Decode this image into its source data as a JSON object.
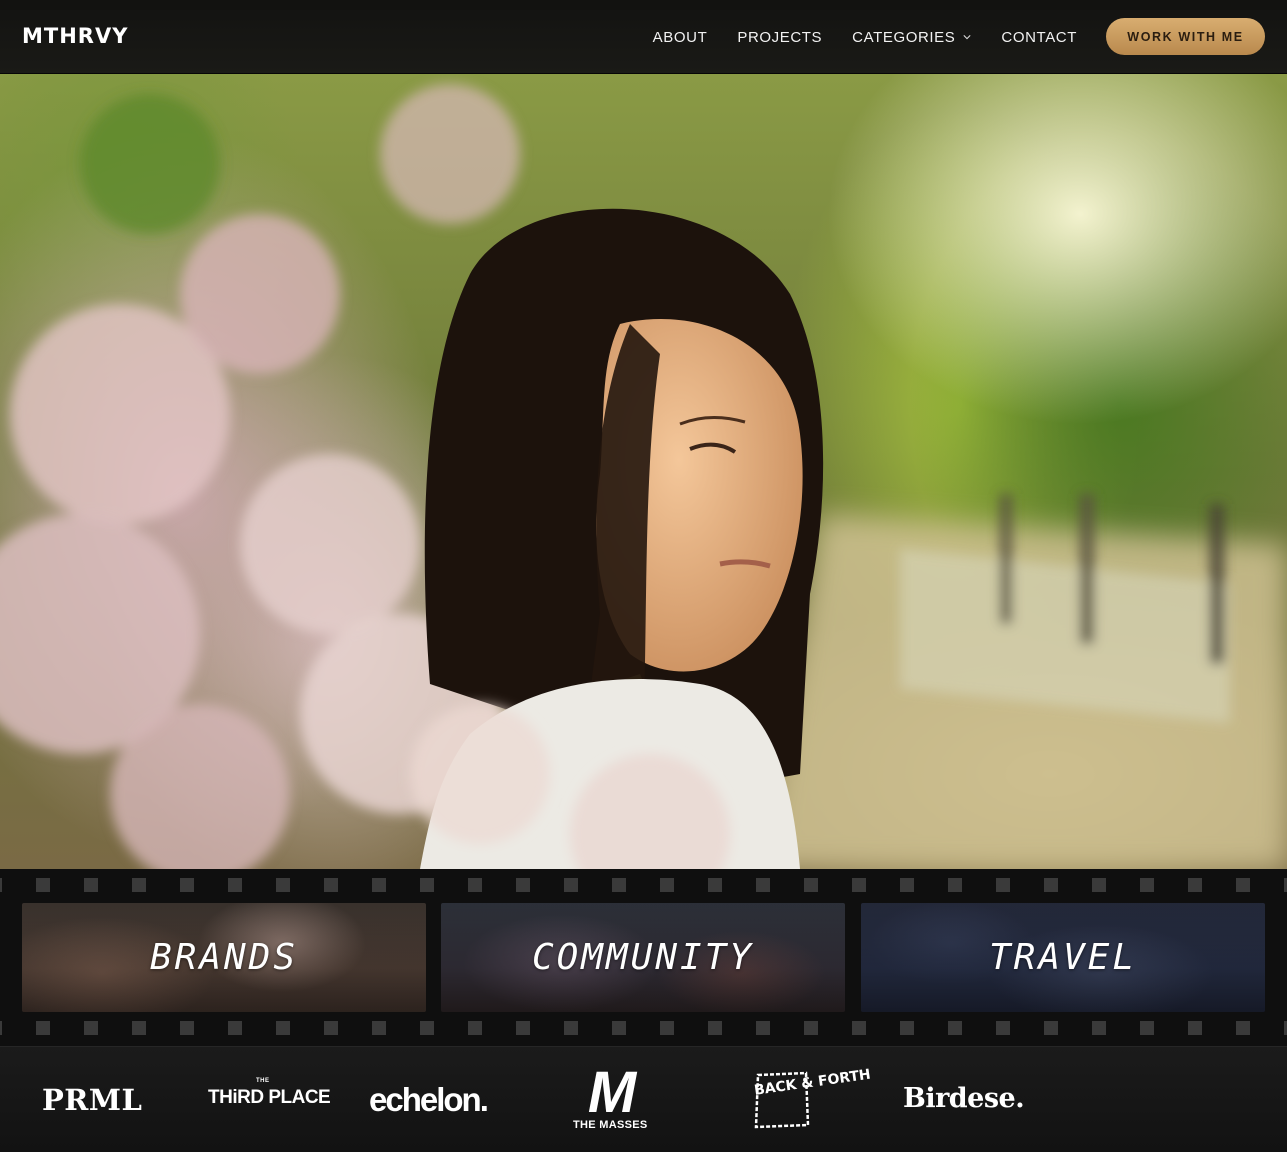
{
  "header": {
    "logo": "MTHRVY",
    "nav": {
      "about": "ABOUT",
      "projects": "PROJECTS",
      "categories": "CATEGORIES",
      "contact": "CONTACT"
    },
    "cta_label": "WORK WITH ME"
  },
  "hero": {
    "image_subject": "woman-beside-lilac-bush-on-sunlit-path"
  },
  "categories": {
    "brands": "BRANDS",
    "community": "COMMUNITY",
    "travel": "TRAVEL"
  },
  "client_logos": {
    "prml": "PRML",
    "third_place_small": "THE",
    "third_place": "THiRD PLACE",
    "echelon": "echelon.",
    "masses_mark": "M",
    "masses": "THE MASSES",
    "back_and_forth": "BACK & FORTH",
    "birdese": "Birdese."
  },
  "colors": {
    "cta_gold": "#c89a5c",
    "header_bg": "#1a1a17",
    "film_bg": "#0f0f0f"
  }
}
